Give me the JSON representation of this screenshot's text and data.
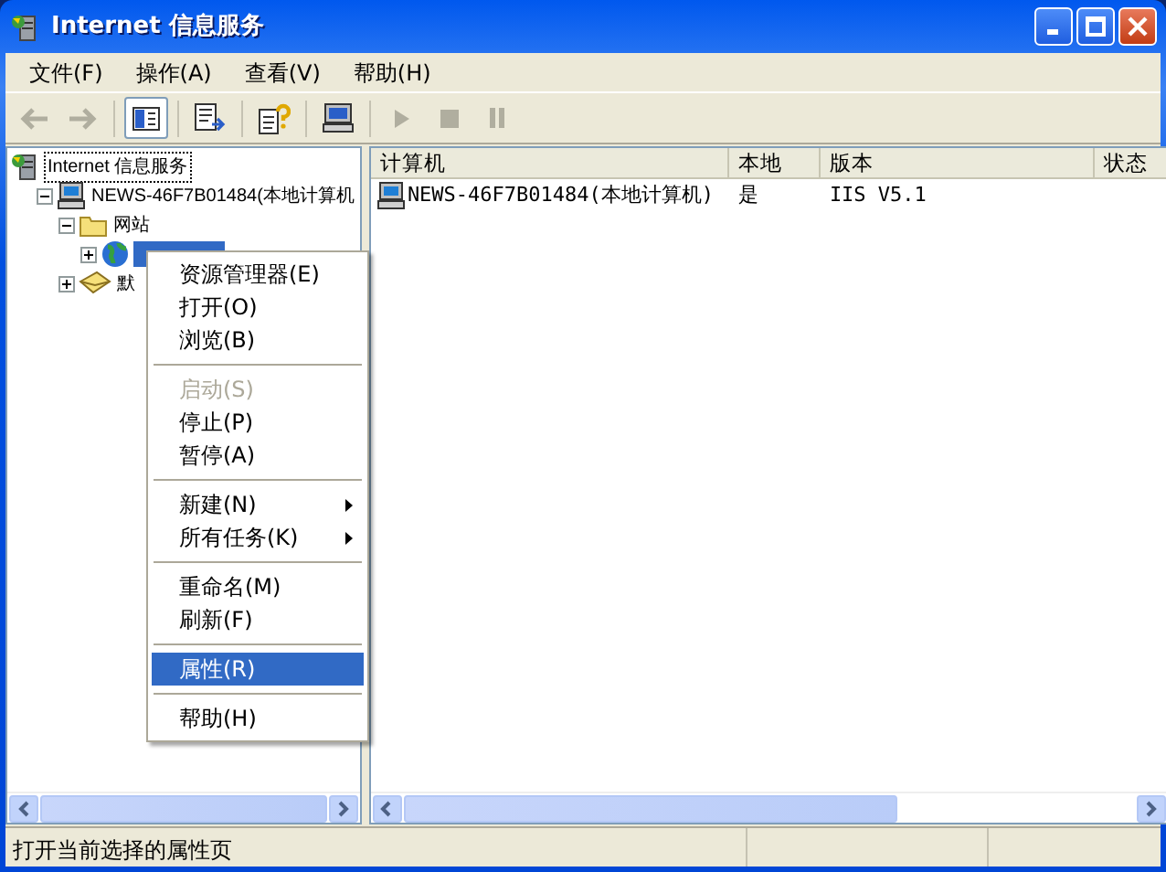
{
  "window": {
    "title": "Internet 信息服务"
  },
  "menu_bar": [
    {
      "label": "文件(F)"
    },
    {
      "label": "操作(A)"
    },
    {
      "label": "查看(V)"
    },
    {
      "label": "帮助(H)"
    }
  ],
  "toolbar": [
    {
      "kind": "back",
      "disabled": true
    },
    {
      "kind": "forward",
      "disabled": true
    },
    {
      "kind": "sep"
    },
    {
      "kind": "tree",
      "disabled": false,
      "selected": true
    },
    {
      "kind": "sep"
    },
    {
      "kind": "export",
      "disabled": false,
      "selected": false
    },
    {
      "kind": "sep"
    },
    {
      "kind": "help",
      "disabled": false,
      "selected": false
    },
    {
      "kind": "sep"
    },
    {
      "kind": "computer",
      "disabled": false,
      "selected": false
    },
    {
      "kind": "sep"
    },
    {
      "kind": "play",
      "disabled": true
    },
    {
      "kind": "stop",
      "disabled": true
    },
    {
      "kind": "pause",
      "disabled": true
    }
  ],
  "tree": [
    {
      "label": "Internet 信息服务",
      "expanded": true,
      "selected": false,
      "children": [
        {
          "label": "NEWS-46F7B01484(本地计算机",
          "expanded": true,
          "selected": false,
          "children": [
            {
              "label": "网站",
              "expanded": true,
              "selected": false,
              "children": [
                {
                  "expanded": false,
                  "selected": true
                }
              ]
            },
            {
              "label": "默",
              "expanded": false,
              "selected": false
            }
          ]
        }
      ]
    }
  ],
  "list": {
    "columns": [
      "计算机",
      "本地",
      "版本",
      "状态"
    ],
    "rows": [
      {
        "cells": [
          "NEWS-46F7B01484(本地计算机)",
          "是",
          "IIS V5.1"
        ]
      }
    ]
  },
  "context_menu": [
    {
      "kind": "item",
      "label": "资源管理器(E)",
      "disabled": false,
      "selected": false
    },
    {
      "kind": "item",
      "label": "打开(O)",
      "disabled": false,
      "selected": false
    },
    {
      "kind": "item",
      "label": "浏览(B)",
      "disabled": false,
      "selected": false
    },
    {
      "kind": "separator"
    },
    {
      "kind": "item",
      "label": "启动(S)",
      "disabled": true,
      "selected": false
    },
    {
      "kind": "item",
      "label": "停止(P)",
      "disabled": false,
      "selected": false
    },
    {
      "kind": "item",
      "label": "暂停(A)",
      "disabled": false,
      "selected": false
    },
    {
      "kind": "separator"
    },
    {
      "kind": "submenu",
      "label": "新建(N)",
      "disabled": false,
      "selected": false
    },
    {
      "kind": "submenu",
      "label": "所有任务(K)",
      "disabled": false,
      "selected": false
    },
    {
      "kind": "separator"
    },
    {
      "kind": "item",
      "label": "重命名(M)",
      "disabled": false,
      "selected": false
    },
    {
      "kind": "item",
      "label": "刷新(F)",
      "disabled": false,
      "selected": false
    },
    {
      "kind": "separator"
    },
    {
      "kind": "item",
      "label": "属性(R)",
      "disabled": false,
      "selected": true
    },
    {
      "kind": "separator"
    },
    {
      "kind": "item",
      "label": "帮助(H)",
      "disabled": false,
      "selected": false
    }
  ],
  "status_bar": {
    "text": "打开当前选择的属性页"
  }
}
